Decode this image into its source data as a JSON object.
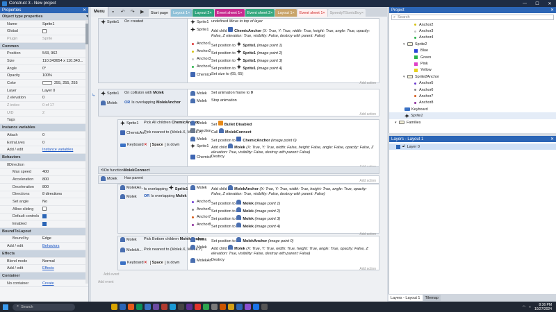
{
  "title": "Construct 3 - New project",
  "properties": {
    "header": "Properties",
    "rows": [
      {
        "type": "sec",
        "k": "Object type properties"
      },
      {
        "k": "Name",
        "v": "Sprite1"
      },
      {
        "k": "Global",
        "v": "",
        "cb": false
      },
      {
        "k": "Plugin",
        "v": "Sprite",
        "dis": true
      },
      {
        "type": "sec",
        "k": "Common"
      },
      {
        "k": "Position",
        "v": "543, 962"
      },
      {
        "k": "Size",
        "v": "110.343654 x 110.343..."
      },
      {
        "k": "Angle",
        "v": "0°"
      },
      {
        "k": "Opacity",
        "v": "100%"
      },
      {
        "k": "Color",
        "v": "255, 255, 255",
        "swatch": true
      },
      {
        "k": "Layer",
        "v": "Layer 0"
      },
      {
        "k": "Z elevation",
        "v": "0"
      },
      {
        "k": "Z index",
        "v": "0 of 17",
        "dis": true
      },
      {
        "k": "UID",
        "v": "2",
        "dis": true
      },
      {
        "k": "Tags",
        "v": ""
      },
      {
        "type": "sec",
        "k": "Instance variables"
      },
      {
        "k": "Attach",
        "v": "0"
      },
      {
        "k": "ExtraLives",
        "v": "0"
      },
      {
        "k": "Add / edit",
        "v": "Instance variables",
        "link": true
      },
      {
        "type": "sec",
        "k": "Behaviors"
      },
      {
        "k": "8Direction",
        "v": "",
        "type2": "sub0"
      },
      {
        "k": "Max speed",
        "v": "400",
        "sub": true
      },
      {
        "k": "Acceleration",
        "v": "800",
        "sub": true
      },
      {
        "k": "Deceleration",
        "v": "800",
        "sub": true
      },
      {
        "k": "Directions",
        "v": "8 directions",
        "sub": true
      },
      {
        "k": "Set angle",
        "v": "No",
        "sub": true
      },
      {
        "k": "Allow sliding",
        "v": "",
        "cb": false,
        "sub": true
      },
      {
        "k": "Default controls",
        "v": "",
        "cb": true,
        "sub": true
      },
      {
        "k": "Enabled",
        "v": "",
        "cb": true,
        "sub": true
      },
      {
        "type": "sec",
        "k": "BoundToLayout"
      },
      {
        "k": "Bound by",
        "v": "Edge",
        "sub": true
      },
      {
        "k": "Add / edit",
        "v": "Behaviors",
        "link": true
      },
      {
        "type": "sec",
        "k": "Effects"
      },
      {
        "k": "Blend mode",
        "v": "Normal"
      },
      {
        "k": "Add / edit",
        "v": "Effects",
        "link": true
      },
      {
        "type": "sec",
        "k": "Container"
      },
      {
        "k": "No container",
        "v": "Create",
        "link": true
      }
    ]
  },
  "toolbar": {
    "menu": "Menu",
    "undo": "↶",
    "redo": "↷",
    "play": "▶"
  },
  "tabs": [
    {
      "label": "Start page",
      "bg": "#e9ecf0",
      "fg": "#222"
    },
    {
      "label": "Layout 1",
      "bg": "#8fc1d8",
      "fg": "#fff"
    },
    {
      "label": "Layout 2",
      "bg": "#2fa37d",
      "fg": "#fff"
    },
    {
      "label": "Event sheet 1",
      "bg": "#c8298f",
      "fg": "#fff"
    },
    {
      "label": "Event sheet 2",
      "bg": "#36a87e",
      "fg": "#fff"
    },
    {
      "label": "Layout 1",
      "bg": "#c9a46a",
      "fg": "#fff"
    },
    {
      "label": "Event sheet 1",
      "bg": "#fff0f0",
      "fg": "#c22"
    },
    {
      "label": "SpeedyTSonicBoy",
      "bg": "#e9ecf0",
      "fg": "#999"
    }
  ],
  "events": {
    "e1": {
      "cond": {
        "obj": "Sprite1",
        "text": "On created"
      },
      "actions": [
        {
          "obj": "Sprite1",
          "text": "Move to top of layer"
        },
        {
          "obj": "Sprite1",
          "pre": "Add child",
          "bold": "ChemicAnchor",
          "text": "(X: True, Y: True, width: True, height: True, angle: True, opacity: False, Z elevation: True, visibility: False, destroy with parent: False)"
        },
        {
          "obj": "Anchor1",
          "color": "#d33",
          "pre": "Set position to",
          "bold": "Sprite1",
          "text": "(image point 1)"
        },
        {
          "obj": "Anchor2",
          "color": "#d6c318",
          "pre": "Set position to",
          "bold": "Sprite1",
          "text": "(image point 2)"
        },
        {
          "obj": "Anchor3",
          "color": "#c6c6c6",
          "pre": "Set position to",
          "bold": "Sprite1",
          "text": "(image point 3)"
        },
        {
          "obj": "Anchor4",
          "color": "#2ab34a",
          "pre": "Set position to",
          "bold": "Sprite1",
          "text": "(image point 4)"
        },
        {
          "obj": "ChemicAnch...",
          "pre": "Set size to (65, 65)",
          "bold": "",
          "text": ""
        }
      ]
    },
    "e2": {
      "c1": {
        "obj": "Sprite1",
        "text": "On collision with",
        "bold": "Molek"
      },
      "c2": {
        "obj": "Molek",
        "or": "OR",
        "text": "Is overlapping",
        "bold": "MolekAnchor"
      },
      "actions": [
        {
          "obj": "Molek",
          "pre": "Set animation frame to",
          "bold": "0",
          "text": ""
        },
        {
          "obj": "Molek",
          "pre": "Stop animation",
          "bold": "",
          "text": ""
        }
      ]
    },
    "e3": {
      "c1": {
        "obj": "Sprite1",
        "text": "Pick All children",
        "bold": "ChemicAnchor"
      },
      "c2": {
        "obj": "ChemicAn...",
        "text": "Pick nearest to (Molek.X, Molek.Y)",
        "bold": ""
      },
      "c3": {
        "obj": "Keyboard",
        "text": "is down",
        "key": "Space"
      },
      "actions": [
        {
          "obj": "Molek",
          "pre": "Set",
          "bold": "Bullet Disabled",
          "text": ""
        },
        {
          "obj": "Functions",
          "pre": "Call",
          "bold": "MolekConnect",
          "text": ""
        },
        {
          "obj": "Molek",
          "pre": "Set position to",
          "bold": "ChemicAnchor",
          "text": "(image point 0)"
        },
        {
          "obj": "Sprite1",
          "pre": "Add child",
          "bold": "Molek",
          "text": "(X: True, Y: True, width: False, height: False, angle: False, opacity: False, Z elevation: True, visibility: False, destroy with parent: False)"
        },
        {
          "obj": "ChemicAn...",
          "pre": "Destroy",
          "bold": "",
          "text": ""
        }
      ]
    },
    "fn": {
      "label": "On function",
      "bold": "MolekConnect"
    },
    "e4": {
      "c1": {
        "obj": "Molek",
        "text": "Has parent"
      },
      "c2": {
        "obj": "MolekAn...",
        "text": "Is overlapping",
        "bold": "Sprite1"
      },
      "c3": {
        "obj": "Molek",
        "or": "OR",
        "text": "Is overlapping",
        "bold": "Molek"
      },
      "actions": [
        {
          "obj": "Molek",
          "pre": "Add child",
          "bold": "MolekAnchor",
          "text": "(X: True, Y: True, width: True, height: True, angle: True, opacity: False, Z elevation: True, visibility: False, destroy with parent: False)"
        },
        {
          "obj": "Anchor5",
          "color": "#6c3bd0",
          "pre": "Set position to",
          "bold": "Molek",
          "text": "(image point 1)"
        },
        {
          "obj": "Anchor6",
          "color": "#888",
          "pre": "Set position to",
          "bold": "Molek",
          "text": "(image point 2)"
        },
        {
          "obj": "Anchor7",
          "color": "#d55b1a",
          "pre": "Set position to",
          "bold": "Molek",
          "text": "(image point 3)"
        },
        {
          "obj": "Anchor8",
          "color": "#8a2a9a",
          "pre": "Set position to",
          "bold": "Molek",
          "text": "(image point 4)"
        }
      ]
    },
    "e5": {
      "c1": {
        "obj": "Molek",
        "text": "Pick Bottom children",
        "bold": "MolekAnchor"
      },
      "c2": {
        "obj": "MolekA...",
        "text": "Pick nearest to (Molek.X, Molek.Y)",
        "bold": ""
      },
      "c3": {
        "obj": "Keyboard",
        "text": "is down",
        "key": "Space"
      },
      "actions": [
        {
          "obj": "Molek",
          "pre": "Set position to",
          "bold": "MolekAnchor",
          "text": "(image point 0)"
        },
        {
          "obj": "Molek",
          "pre": "Add child",
          "bold": "Molek",
          "text": "(X: True, Y: True, width: True, height: True, angle: True, opacity: False, Z elevation: True, visibility: False, destroy with parent: False)"
        },
        {
          "obj": "MolekAn...",
          "pre": "Destroy",
          "bold": "",
          "text": ""
        }
      ]
    },
    "add_action": "Add action",
    "add_event": "Add event"
  },
  "project": {
    "header": "Project",
    "search_placeholder": "Search",
    "rows": [
      {
        "t": "dot",
        "label": "Anchor2",
        "color": "#d6c318",
        "indent": 36
      },
      {
        "t": "dot",
        "label": "Anchor3",
        "color": "#c6c6c6",
        "indent": 36
      },
      {
        "t": "dot",
        "label": "Anchor4",
        "color": "#2ab34a",
        "indent": 36
      },
      {
        "t": "folder",
        "label": "Sprite2",
        "indent": 20
      },
      {
        "t": "sq",
        "label": "Blue",
        "color": "#2a43d6",
        "indent": 36
      },
      {
        "t": "sq",
        "label": "Green",
        "color": "#2ab34a",
        "indent": 36
      },
      {
        "t": "sq",
        "label": "Pink",
        "color": "#e040c8",
        "indent": 36
      },
      {
        "t": "sq",
        "label": "Yellow",
        "color": "#e6d01e",
        "indent": 36
      },
      {
        "t": "folder",
        "label": "Sprite2Anchor",
        "indent": 20
      },
      {
        "t": "dot",
        "label": "Anchor5",
        "color": "#6c3bd0",
        "indent": 36
      },
      {
        "t": "dot",
        "label": "Anchor6",
        "color": "#888",
        "indent": 36
      },
      {
        "t": "dot",
        "label": "Anchor7",
        "color": "#d55b1a",
        "indent": 36
      },
      {
        "t": "dot",
        "label": "Anchor8",
        "color": "#8a2a9a",
        "indent": 36
      },
      {
        "t": "kbd",
        "label": "Keyboard",
        "indent": 22
      },
      {
        "t": "sprite",
        "label": "Sprite1",
        "indent": 22,
        "italic": true
      },
      {
        "t": "folder",
        "label": "Families",
        "indent": 8
      }
    ]
  },
  "layers": {
    "header": "Layers - Layout 1",
    "layer": "Layer 0"
  },
  "bottom_tabs": [
    "Layers - Layout 1",
    "Tilemap"
  ],
  "taskbar": {
    "search": "Search",
    "time": "8:36 PM",
    "date": "10/27/2024"
  }
}
